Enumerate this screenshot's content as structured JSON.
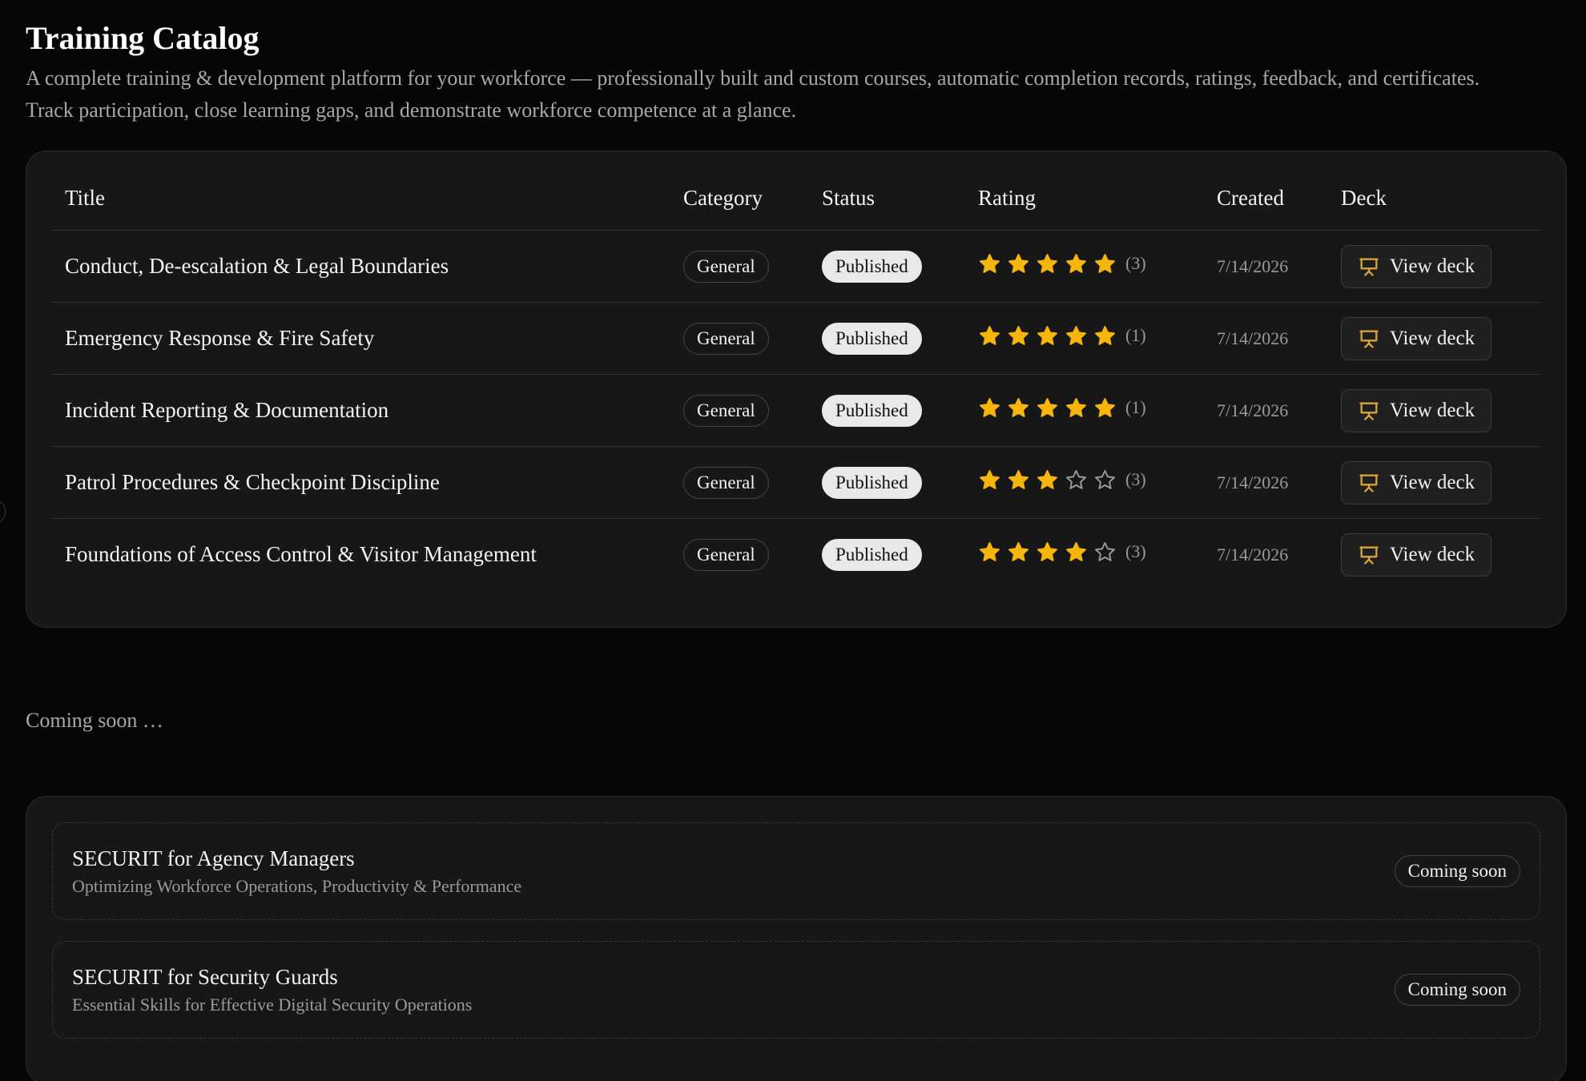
{
  "header": {
    "title": "Training Catalog",
    "description": "A complete training & development platform for your workforce — professionally built and custom courses, automatic completion records, ratings, feedback, and certificates. Track participation, close learning gaps, and demonstrate workforce competence at a glance."
  },
  "table": {
    "columns": [
      "Title",
      "Category",
      "Status",
      "Rating",
      "Created",
      "Deck"
    ],
    "rows": [
      {
        "title": "Conduct, De-escalation & Legal Boundaries",
        "category": "General",
        "status": "Published",
        "rating": 5,
        "count": "(3)",
        "created": "7/14/2026",
        "deck": "View deck"
      },
      {
        "title": "Emergency Response & Fire Safety",
        "category": "General",
        "status": "Published",
        "rating": 5,
        "count": "(1)",
        "created": "7/14/2026",
        "deck": "View deck"
      },
      {
        "title": "Incident Reporting & Documentation",
        "category": "General",
        "status": "Published",
        "rating": 5,
        "count": "(1)",
        "created": "7/14/2026",
        "deck": "View deck"
      },
      {
        "title": "Patrol Procedures & Checkpoint Discipline",
        "category": "General",
        "status": "Published",
        "rating": 3,
        "count": "(3)",
        "created": "7/14/2026",
        "deck": "View deck"
      },
      {
        "title": "Foundations of Access Control & Visitor Management",
        "category": "General",
        "status": "Published",
        "rating": 4,
        "count": "(3)",
        "created": "7/14/2026",
        "deck": "View deck"
      }
    ]
  },
  "coming_soon": {
    "label": "Coming soon …",
    "items": [
      {
        "title": "SECURIT for Agency Managers",
        "subtitle": "Optimizing Workforce Operations, Productivity & Performance",
        "badge": "Coming soon"
      },
      {
        "title": "SECURIT for Security Guards",
        "subtitle": "Essential Skills for Effective Digital Security Operations",
        "badge": "Coming soon"
      }
    ]
  },
  "colors": {
    "star_filled": "#f5b50a",
    "star_empty": "#9a9a9a",
    "deck_icon": "#d9a23a"
  }
}
